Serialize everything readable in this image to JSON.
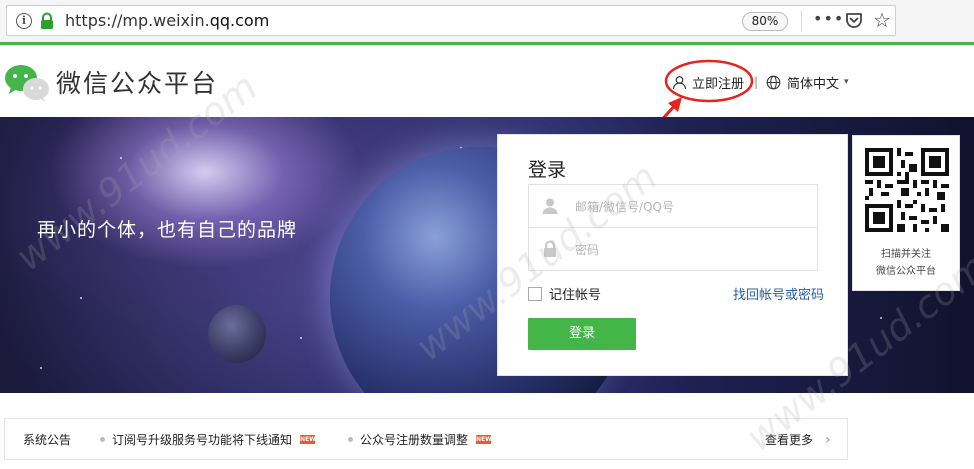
{
  "browser": {
    "url_prefix": "https://mp.weixin.",
    "url_host": "qq.com",
    "zoom": "80%",
    "more_icon": "ellipsis-icon",
    "pocket_icon": "pocket-icon",
    "bookmark_icon": "star-icon"
  },
  "header": {
    "title": "微信公众平台",
    "register_label": "立即注册",
    "divider": "|",
    "language_label": "简体中文",
    "language_caret": "▾"
  },
  "banner": {
    "slogan": "再小的个体，也有自己的品牌"
  },
  "login": {
    "title": "登录",
    "username_placeholder": "邮箱/微信号/QQ号",
    "password_placeholder": "密码",
    "remember_label": "记住帐号",
    "recover_label": "找回帐号或密码",
    "submit_label": "登录"
  },
  "qr": {
    "line1": "扫描并关注",
    "line2": "微信公众平台"
  },
  "notices": {
    "label": "系统公告",
    "items": [
      {
        "text": "订阅号升级服务号功能将下线通知",
        "badge": "NEW"
      },
      {
        "text": "公众号注册数量调整",
        "badge": "NEW"
      }
    ],
    "more_label": "查看更多",
    "more_chevron": "›"
  },
  "colors": {
    "brand_green": "#44b549",
    "link_blue": "#2a5ca6",
    "annotation_red": "#e8231e",
    "badge_red": "#e85a34"
  },
  "watermark": "www.91ud.com"
}
